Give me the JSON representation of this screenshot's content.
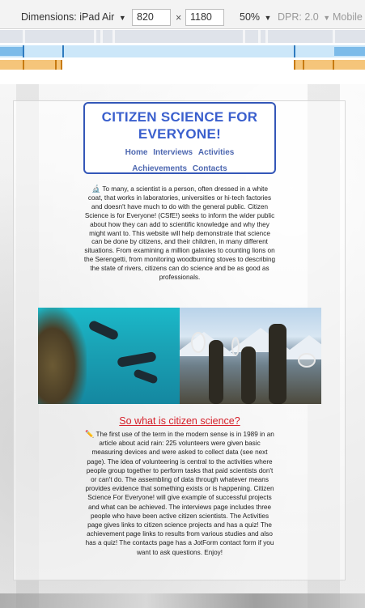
{
  "devtools": {
    "dimensions_label": "Dimensions: iPad Air",
    "width": "820",
    "times": "×",
    "height": "1180",
    "zoom": "50%",
    "dpr": "DPR: 2.0",
    "mode": "Mobile",
    "caret": "▼"
  },
  "site": {
    "title": "CITIZEN SCIENCE FOR EVERYONE!",
    "nav": [
      "Home",
      "Interviews",
      "Activities",
      "Achievements",
      "Contacts"
    ]
  },
  "intro": {
    "emoji": "🔬",
    "text": "To many, a scientist is a person, often dressed in a white coat, that works in laboratories, universities or hi-tech factories and doesn't have much to do with the general public. Citizen Science is for Everyone! (CSfE!) seeks to inform the wider public about how they can add to scientific knowledge and why they might want to. This website will help demonstrate that science can be done by citizens, and their children, in many different situations. From examining a million galaxies to counting lions on the Serengetti, from monitoring woodburning stoves to describing the state of rivers, citizens can do science and be as good as professionals."
  },
  "section": {
    "title": "So what is citizen science?",
    "emoji": "✏️",
    "text": "The first use of the term in the modern sense is in 1989 in an article about acid rain: 225 volunteers were given basic measuring devices and were asked to collect data (see next page). The idea of volunteering is central to the activities where people group together to perform tasks that paid scientists don't or can't do. The assembling of data through whatever means provides evidence that something exists or is happening. Citizen Science For Everyone! will give example of successful projects and what can be achieved. The interviews page includes three people who have been active citizen scientists. The Activities page gives links to citizen science projects and has a quiz! The achievement page links to results from various studies and also has a quiz! The contacts page has a JotForm contact form if you want to ask questions. Enjoy!"
  },
  "colors": {
    "title": "#3a5fcd",
    "section_title": "#d6202a",
    "border": "#3457b8"
  }
}
